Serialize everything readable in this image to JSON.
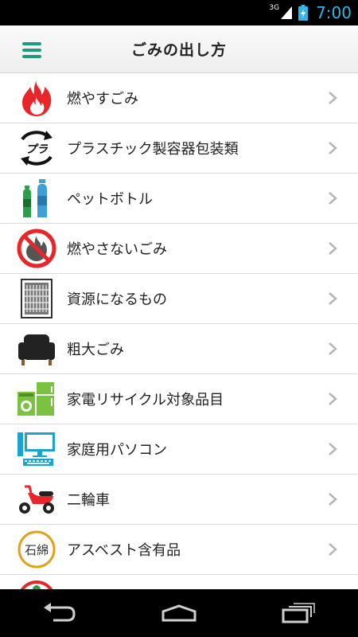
{
  "status_bar": {
    "network": "3G",
    "time": "7:00"
  },
  "app_bar": {
    "title": "ごみの出し方"
  },
  "items": [
    {
      "label": "燃やすごみ",
      "icon": "fire-icon"
    },
    {
      "label": "プラスチック製容器包装類",
      "icon": "plastic-recycle-icon"
    },
    {
      "label": "ペットボトル",
      "icon": "pet-bottle-icon"
    },
    {
      "label": "燃やさないごみ",
      "icon": "no-burn-icon"
    },
    {
      "label": "資源になるもの",
      "icon": "recyclable-resource-icon"
    },
    {
      "label": "粗大ごみ",
      "icon": "sofa-icon"
    },
    {
      "label": "家電リサイクル対象品目",
      "icon": "appliance-icon"
    },
    {
      "label": "家庭用パソコン",
      "icon": "computer-icon"
    },
    {
      "label": "二輪車",
      "icon": "scooter-icon"
    },
    {
      "label": "アスベスト含有品",
      "icon": "asbestos-icon",
      "icon_text": "石綿"
    },
    {
      "label": "",
      "icon": "partial-icon"
    }
  ],
  "plastic_icon_text": "プラ",
  "colors": {
    "accent": "#1e9a7f",
    "fire": "#e8262a",
    "status": "#33b5e5"
  }
}
